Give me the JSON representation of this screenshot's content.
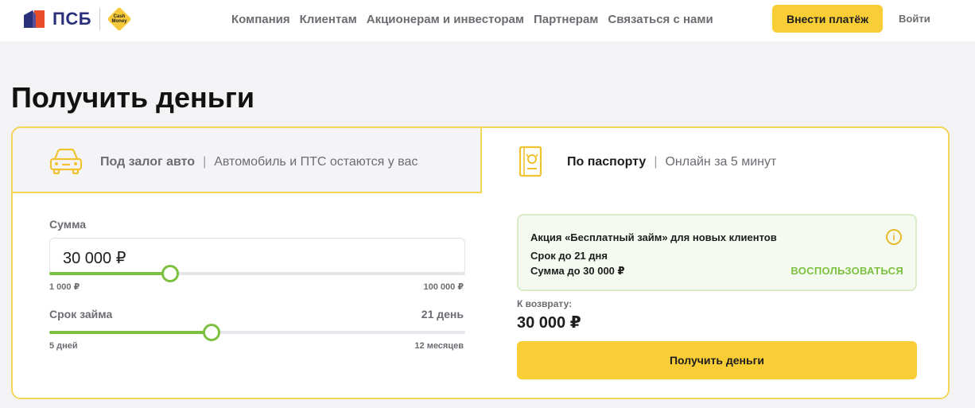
{
  "header": {
    "logo_text": "ПСБ",
    "cash_badge_text": "Cash Money",
    "nav": [
      "Компания",
      "Клиентам",
      "Акционерам и инвесторам",
      "Партнерам",
      "Связаться с нами"
    ],
    "pay_button": "Внести платёж",
    "login": "Войти"
  },
  "page_title": "Получить деньги",
  "tabs": {
    "auto": {
      "label": "Под залог авто",
      "sep": "|",
      "desc": "Автомобиль и ПТС остаются у вас",
      "icon": "car-icon"
    },
    "passport": {
      "label": "По паспорту",
      "sep": "|",
      "desc": "Онлайн за 5 минут",
      "icon": "passport-icon"
    }
  },
  "amount": {
    "label": "Сумма",
    "value": "30 000 ₽",
    "min_label": "1 000 ₽",
    "max_label": "100 000 ₽",
    "level": 0.29
  },
  "term": {
    "label": "Срок займа",
    "value": "21 день",
    "min_label": "5 дней",
    "max_label": "12 месяцев",
    "level": 0.39
  },
  "promo": {
    "title": "Акция «Бесплатный займ» для новых клиентов",
    "line1": "Срок до 21 дня",
    "line2": "Сумма до 30 000 ₽",
    "action": "ВОСПОЛЬЗОВАТЬСЯ",
    "info_glyph": "i"
  },
  "return": {
    "label": "К возврату:",
    "value": "30 000 ₽"
  },
  "submit_button": "Получить деньги",
  "colors": {
    "accent_yellow": "#f8cd35",
    "accent_green": "#7cc040",
    "brand_blue": "#2a2f7a",
    "brand_red": "#e94e2a"
  }
}
